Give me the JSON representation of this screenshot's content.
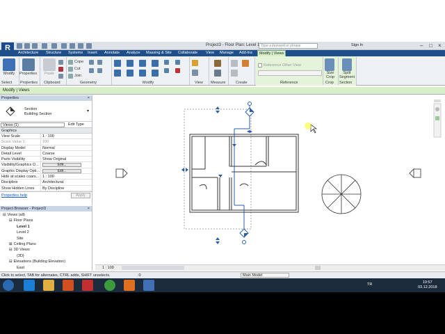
{
  "title": "Project3 - Floor Plan: Level 1",
  "search": {
    "placeholder": "Type a keyword or phrase"
  },
  "signin": "Sign In",
  "tabs": [
    "R",
    "Architecture",
    "Structure",
    "Systems",
    "Insert",
    "Annotate",
    "Analyze",
    "Massing & Site",
    "Collaborate",
    "View",
    "Manage",
    "Add-Ins",
    "Modify | Views"
  ],
  "ribbon": {
    "modify": "Modify",
    "properties": "Properties",
    "paste": "Paste",
    "cope": "Cope",
    "cut": "Cut",
    "join": "Join",
    "reference_other_view": "Reference Other View",
    "size_crop": "Size Crop",
    "split_segment": "Split Segment",
    "panels": [
      "Select",
      "Properties",
      "Clipboard",
      "Geometry",
      "Modify",
      "View",
      "Measure",
      "Create",
      "Reference",
      "Crop",
      "Section"
    ]
  },
  "optbar": "Modify | Views",
  "properties": {
    "header": "Properties",
    "type_name": "Section",
    "type_sub": "Building Section",
    "filter": "Views (1)",
    "edit_type": "Edit Type",
    "group": "Graphics",
    "rows": [
      {
        "k": "View Scale",
        "v": "1 : 100"
      },
      {
        "k": "Scale Value    1:",
        "v": "100",
        "dim": true
      },
      {
        "k": "Display Model",
        "v": "Normal"
      },
      {
        "k": "Detail Level",
        "v": "Coarse"
      },
      {
        "k": "Parts Visibility",
        "v": "Show Original"
      },
      {
        "k": "Visibility/Graphics O...",
        "v": "Edit...",
        "btn": true
      },
      {
        "k": "Graphic Display Opti...",
        "v": "Edit...",
        "btn": true
      },
      {
        "k": "Hide at scales coars...",
        "v": "1 : 100"
      },
      {
        "k": "Discipline",
        "v": "Architectural"
      },
      {
        "k": "Show Hidden Lines",
        "v": "By Discipline"
      }
    ],
    "help": "Properties help",
    "apply": "Apply"
  },
  "browser": {
    "header": "Project Browser - Project3",
    "items": [
      {
        "label": "Views (all)",
        "indent": 0,
        "prefix": "⊟"
      },
      {
        "label": "Floor Plans",
        "indent": 1,
        "prefix": "⊟"
      },
      {
        "label": "Level 1",
        "indent": 2,
        "prefix": "",
        "bold": true
      },
      {
        "label": "Level 2",
        "indent": 2,
        "prefix": ""
      },
      {
        "label": "Site",
        "indent": 2,
        "prefix": ""
      },
      {
        "label": "Ceiling Plans",
        "indent": 1,
        "prefix": "⊞"
      },
      {
        "label": "3D Views",
        "indent": 1,
        "prefix": "⊟"
      },
      {
        "label": "{3D}",
        "indent": 2,
        "prefix": ""
      },
      {
        "label": "Elevations (Building Elevation)",
        "indent": 1,
        "prefix": "⊟"
      },
      {
        "label": "East",
        "indent": 2,
        "prefix": ""
      }
    ]
  },
  "viewbar": {
    "scale": "1 : 100"
  },
  "status": {
    "hint": "Click to select, TAB for alternates, CTRL adds, SHIFT unselects.",
    "coord": ":0",
    "model": "Main Model"
  },
  "taskbar": {
    "lang": "TR",
    "time": "19:57",
    "date": "03.12.2018"
  },
  "colors": {
    "accent": "#1f4f8a",
    "context_tab": "#d8f0c8",
    "taskbar": "#1c2b3c"
  }
}
